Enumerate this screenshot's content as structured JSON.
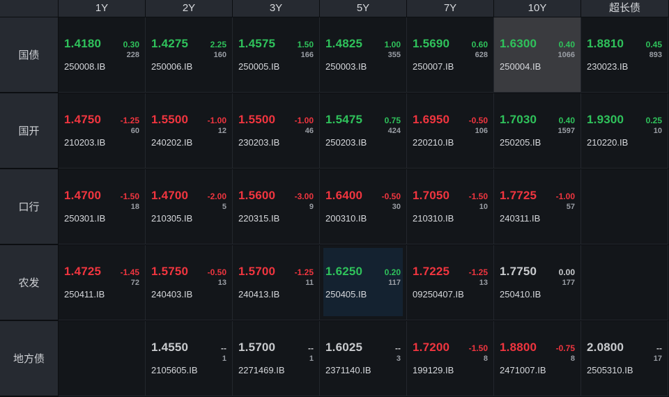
{
  "columns": [
    "1Y",
    "2Y",
    "3Y",
    "5Y",
    "7Y",
    "10Y",
    "超长债"
  ],
  "colors": {
    "up": "#2fc25b",
    "down": "#f0353f",
    "flat": "#c9cbce"
  },
  "rows": [
    {
      "label": "国债",
      "cells": [
        {
          "price": "1.4180",
          "change": "0.30",
          "volume": "228",
          "code": "250008.IB",
          "dir": "green"
        },
        {
          "price": "1.4275",
          "change": "2.25",
          "volume": "160",
          "code": "250006.IB",
          "dir": "green"
        },
        {
          "price": "1.4575",
          "change": "1.50",
          "volume": "166",
          "code": "250005.IB",
          "dir": "green"
        },
        {
          "price": "1.4825",
          "change": "1.00",
          "volume": "355",
          "code": "250003.IB",
          "dir": "green"
        },
        {
          "price": "1.5690",
          "change": "0.60",
          "volume": "628",
          "code": "250007.IB",
          "dir": "green"
        },
        {
          "price": "1.6300",
          "change": "0.40",
          "volume": "1066",
          "code": "250004.IB",
          "dir": "green",
          "sel": "gray"
        },
        {
          "price": "1.8810",
          "change": "0.45",
          "volume": "893",
          "code": "230023.IB",
          "dir": "green"
        }
      ]
    },
    {
      "label": "国开",
      "cells": [
        {
          "price": "1.4750",
          "change": "-1.25",
          "volume": "60",
          "code": "210203.IB",
          "dir": "red"
        },
        {
          "price": "1.5500",
          "change": "-1.00",
          "volume": "12",
          "code": "240202.IB",
          "dir": "red"
        },
        {
          "price": "1.5500",
          "change": "-1.00",
          "volume": "46",
          "code": "230203.IB",
          "dir": "red"
        },
        {
          "price": "1.5475",
          "change": "0.75",
          "volume": "424",
          "code": "250203.IB",
          "dir": "green"
        },
        {
          "price": "1.6950",
          "change": "-0.50",
          "volume": "106",
          "code": "220210.IB",
          "dir": "red"
        },
        {
          "price": "1.7030",
          "change": "0.40",
          "volume": "1597",
          "code": "250205.IB",
          "dir": "green"
        },
        {
          "price": "1.9300",
          "change": "0.25",
          "volume": "10",
          "code": "210220.IB",
          "dir": "green"
        }
      ]
    },
    {
      "label": "口行",
      "cells": [
        {
          "price": "1.4700",
          "change": "-1.50",
          "volume": "18",
          "code": "250301.IB",
          "dir": "red"
        },
        {
          "price": "1.4700",
          "change": "-2.00",
          "volume": "5",
          "code": "210305.IB",
          "dir": "red"
        },
        {
          "price": "1.5600",
          "change": "-3.00",
          "volume": "9",
          "code": "220315.IB",
          "dir": "red"
        },
        {
          "price": "1.6400",
          "change": "-0.50",
          "volume": "30",
          "code": "200310.IB",
          "dir": "red"
        },
        {
          "price": "1.7050",
          "change": "-1.50",
          "volume": "10",
          "code": "210310.IB",
          "dir": "red"
        },
        {
          "price": "1.7725",
          "change": "-1.00",
          "volume": "57",
          "code": "240311.IB",
          "dir": "red"
        },
        null
      ]
    },
    {
      "label": "农发",
      "cells": [
        {
          "price": "1.4725",
          "change": "-1.45",
          "volume": "72",
          "code": "250411.IB",
          "dir": "red"
        },
        {
          "price": "1.5750",
          "change": "-0.50",
          "volume": "13",
          "code": "240403.IB",
          "dir": "red"
        },
        {
          "price": "1.5700",
          "change": "-1.25",
          "volume": "11",
          "code": "240413.IB",
          "dir": "red"
        },
        {
          "price": "1.6250",
          "change": "0.20",
          "volume": "117",
          "code": "250405.IB",
          "dir": "green",
          "sel": "blue"
        },
        {
          "price": "1.7225",
          "change": "-1.25",
          "volume": "13",
          "code": "09250407.IB",
          "dir": "red"
        },
        {
          "price": "1.7750",
          "change": "0.00",
          "volume": "177",
          "code": "250410.IB",
          "dir": "neutral"
        },
        null
      ]
    },
    {
      "label": "地方债",
      "cells": [
        null,
        {
          "price": "1.4550",
          "change": "--",
          "volume": "1",
          "code": "2105605.IB",
          "dir": "neutral"
        },
        {
          "price": "1.5700",
          "change": "--",
          "volume": "1",
          "code": "2271469.IB",
          "dir": "neutral"
        },
        {
          "price": "1.6025",
          "change": "--",
          "volume": "3",
          "code": "2371140.IB",
          "dir": "neutral"
        },
        {
          "price": "1.7200",
          "change": "-1.50",
          "volume": "8",
          "code": "199129.IB",
          "dir": "red"
        },
        {
          "price": "1.8800",
          "change": "-0.75",
          "volume": "8",
          "code": "2471007.IB",
          "dir": "red"
        },
        {
          "price": "2.0800",
          "change": "--",
          "volume": "17",
          "code": "2505310.IB",
          "dir": "neutral"
        }
      ]
    }
  ]
}
